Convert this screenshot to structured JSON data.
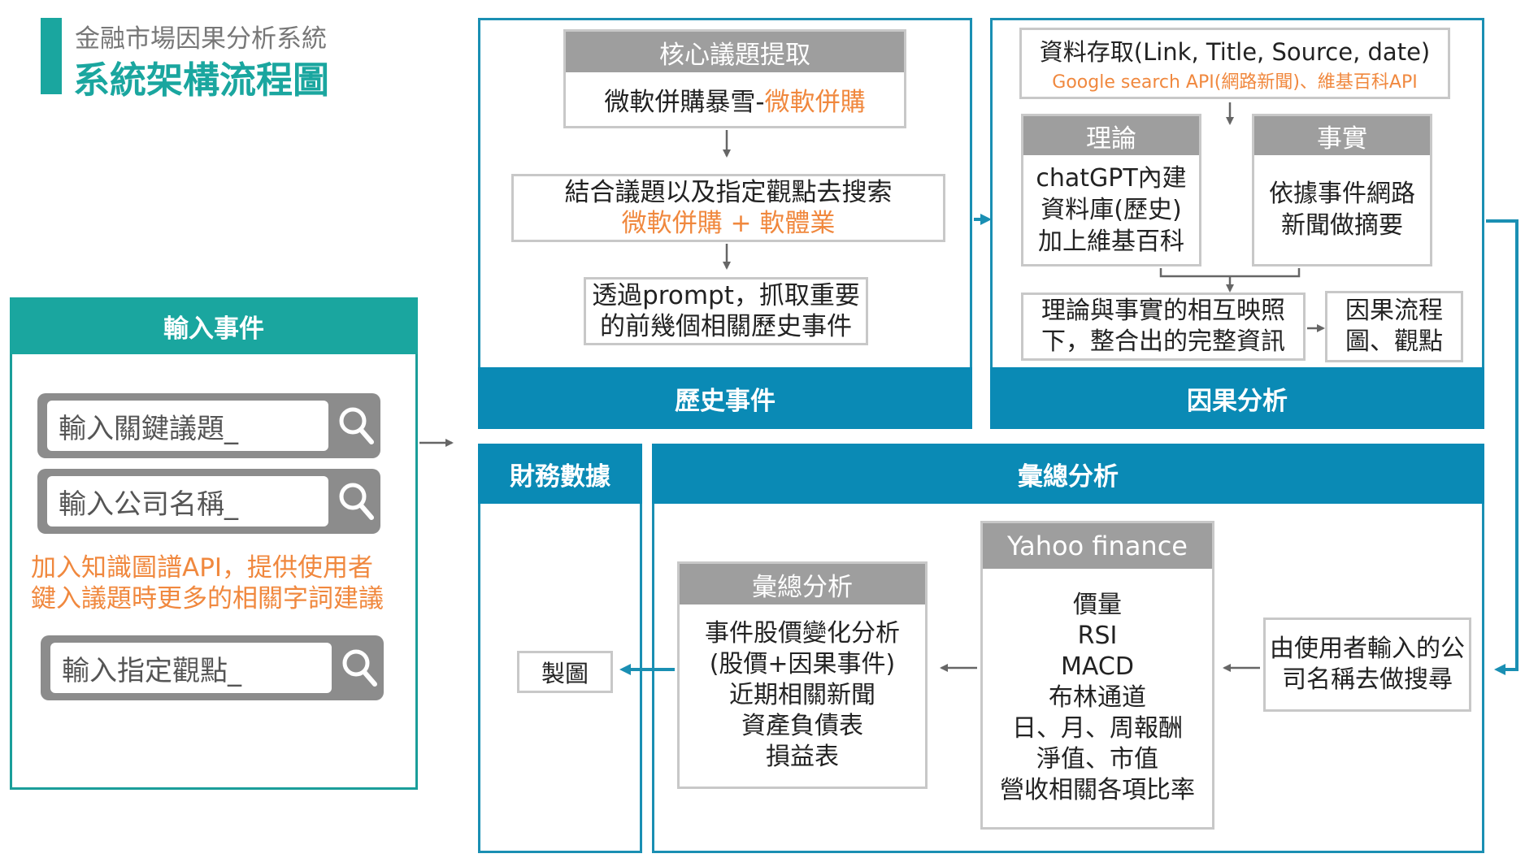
{
  "header": {
    "subtitle": "金融市場因果分析系統",
    "title": "系統架構流程圖",
    "accent_color": "#1aa69f"
  },
  "input_panel": {
    "title": "輸入事件",
    "keyword_placeholder": "輸入關鍵議題_",
    "company_placeholder": "輸入公司名稱_",
    "note_line1": "加入知識圖譜API，提供使用者",
    "note_line2": "鍵入議題時更多的相關字詞建議",
    "viewpoint_placeholder": "輸入指定觀點_",
    "search_icon": "search-icon"
  },
  "history": {
    "band": "歷史事件",
    "core": {
      "header": "核心議題提取",
      "body_plain": "微軟併購暴雪-",
      "body_highlight": "微軟併購"
    },
    "combine": {
      "line1": "結合議題以及指定觀點去搜索",
      "line2": "微軟併購 + 軟體業"
    },
    "prompt": {
      "line1": "透過prompt，抓取重要",
      "line2": "的前幾個相關歷史事件"
    }
  },
  "causal": {
    "band": "因果分析",
    "access": {
      "line1": "資料存取(Link, Title, Source, date)",
      "line2": "Google search API(網路新聞)、維基百科API"
    },
    "theory": {
      "header": "理論",
      "line1": "chatGPT內建",
      "line2": "資料庫(歷史)",
      "line3": "加上維基百科"
    },
    "fact": {
      "header": "事實",
      "line1": "依據事件網路",
      "line2": "新聞做摘要"
    },
    "mapping": {
      "line1": "理論與事實的相互映照",
      "line2": "下，整合出的完整資訊"
    },
    "output": {
      "line1": "因果流程",
      "line2": "圖、觀點"
    }
  },
  "finance": {
    "band": "財務數據",
    "chart": "製圖"
  },
  "summary": {
    "band": "彙總分析",
    "analysis": {
      "header": "彙總分析",
      "lines": [
        "事件股價變化分析",
        "(股價+因果事件)",
        "近期相關新聞",
        "資產負債表",
        "損益表"
      ]
    },
    "yahoo": {
      "header": "Yahoo finance",
      "lines": [
        "價量",
        "RSI",
        "MACD",
        "布林通道",
        "日、月、周報酬",
        "淨值、市值",
        "營收相關各項比率"
      ]
    },
    "user_search": {
      "line1": "由使用者輸入的公",
      "line2": "司名稱去做搜尋"
    }
  },
  "colors": {
    "blue": "#0a8ab5",
    "teal": "#1aa69f",
    "orange": "#f0883e",
    "grey_header": "#9e9e9e"
  }
}
